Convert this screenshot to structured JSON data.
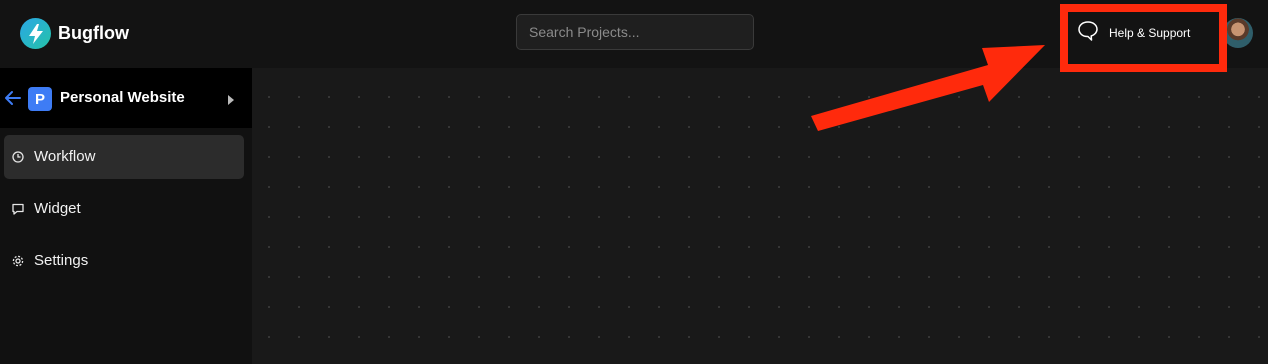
{
  "header": {
    "app_name": "Bugflow",
    "search_placeholder": "Search Projects...",
    "help_label": "Help & Support"
  },
  "sidebar": {
    "project_initial": "P",
    "project_name": "Personal Website",
    "items": [
      {
        "label": "Workflow",
        "icon": "workflow-icon",
        "active": true
      },
      {
        "label": "Widget",
        "icon": "chat-icon",
        "active": false
      },
      {
        "label": "Settings",
        "icon": "gear-icon",
        "active": false
      }
    ]
  },
  "colors": {
    "accent_blue": "#3e7cf5",
    "annotation_red": "#ff2a0c",
    "logo_teal": "#25c3a8"
  }
}
